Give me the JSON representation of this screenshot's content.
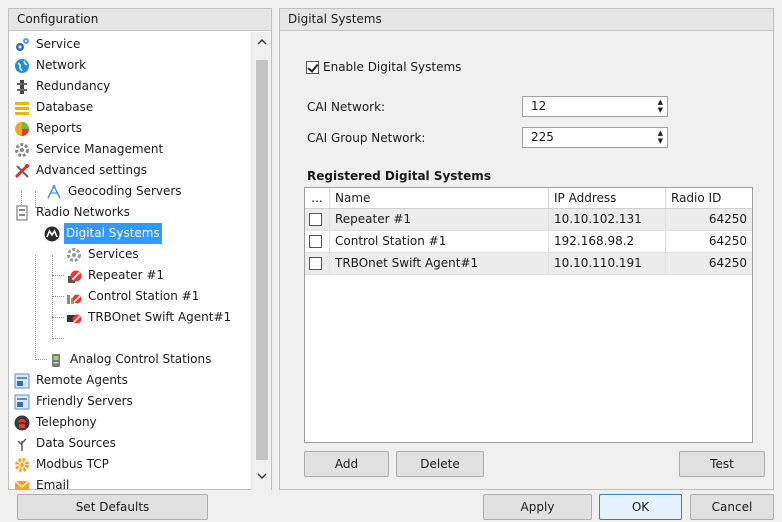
{
  "left_panel": {
    "header": "Configuration",
    "tree": [
      {
        "label": "Service",
        "icon": "service-icon"
      },
      {
        "label": "Network",
        "icon": "network-globe-icon"
      },
      {
        "label": "Redundancy",
        "icon": "redundancy-icon"
      },
      {
        "label": "Database",
        "icon": "database-icon"
      },
      {
        "label": "Reports",
        "icon": "reports-icon"
      },
      {
        "label": "Service Management",
        "icon": "gear-icon"
      },
      {
        "label": "Advanced settings",
        "icon": "tools-icon"
      },
      {
        "label": "Geocoding Servers",
        "icon": "geocoding-icon"
      },
      {
        "label": "Radio Networks",
        "icon": "radio-networks-icon"
      },
      {
        "label": "Digital Systems",
        "icon": "motorola-icon"
      },
      {
        "label": "Services",
        "icon": "gear-icon"
      },
      {
        "label": "Repeater #1",
        "icon": "repeater-icon"
      },
      {
        "label": "Control Station #1",
        "icon": "control-station-icon"
      },
      {
        "label": "TRBOnet Swift Agent#1",
        "icon": "swift-agent-icon"
      },
      {
        "label": "Analog Control Stations",
        "icon": "analog-radio-icon"
      },
      {
        "label": "Remote Agents",
        "icon": "remote-agents-icon"
      },
      {
        "label": "Friendly Servers",
        "icon": "friendly-servers-icon"
      },
      {
        "label": "Telephony",
        "icon": "telephony-icon"
      },
      {
        "label": "Data Sources",
        "icon": "data-sources-icon"
      },
      {
        "label": "Modbus TCP",
        "icon": "modbus-icon"
      },
      {
        "label": "Email",
        "icon": "email-icon"
      }
    ],
    "selected": "Digital Systems"
  },
  "right_panel": {
    "header": "Digital Systems",
    "enable_label": "Enable Digital Systems",
    "enable_checked": true,
    "cai_network_label": "CAI Network:",
    "cai_network_value": "12",
    "cai_group_label": "CAI Group Network:",
    "cai_group_value": "225",
    "section_title": "Registered Digital Systems",
    "grid": {
      "columns": [
        "...",
        "Name",
        "IP Address",
        "Radio ID"
      ],
      "rows": [
        {
          "name": "Repeater #1",
          "ip": "10.10.102.131",
          "radio_id": "64250"
        },
        {
          "name": "Control Station #1",
          "ip": "192.168.98.2",
          "radio_id": "64250"
        },
        {
          "name": "TRBOnet Swift Agent#1",
          "ip": "10.10.110.191",
          "radio_id": "64250"
        }
      ]
    },
    "add_label": "Add",
    "delete_label": "Delete",
    "test_label": "Test"
  },
  "footer": {
    "set_defaults": "Set Defaults",
    "apply": "Apply",
    "ok": "OK",
    "cancel": "Cancel"
  },
  "colors": {
    "selection": "#3399ff",
    "motorola_blue": "#1f5fa8",
    "warning_red": "#e53935"
  }
}
